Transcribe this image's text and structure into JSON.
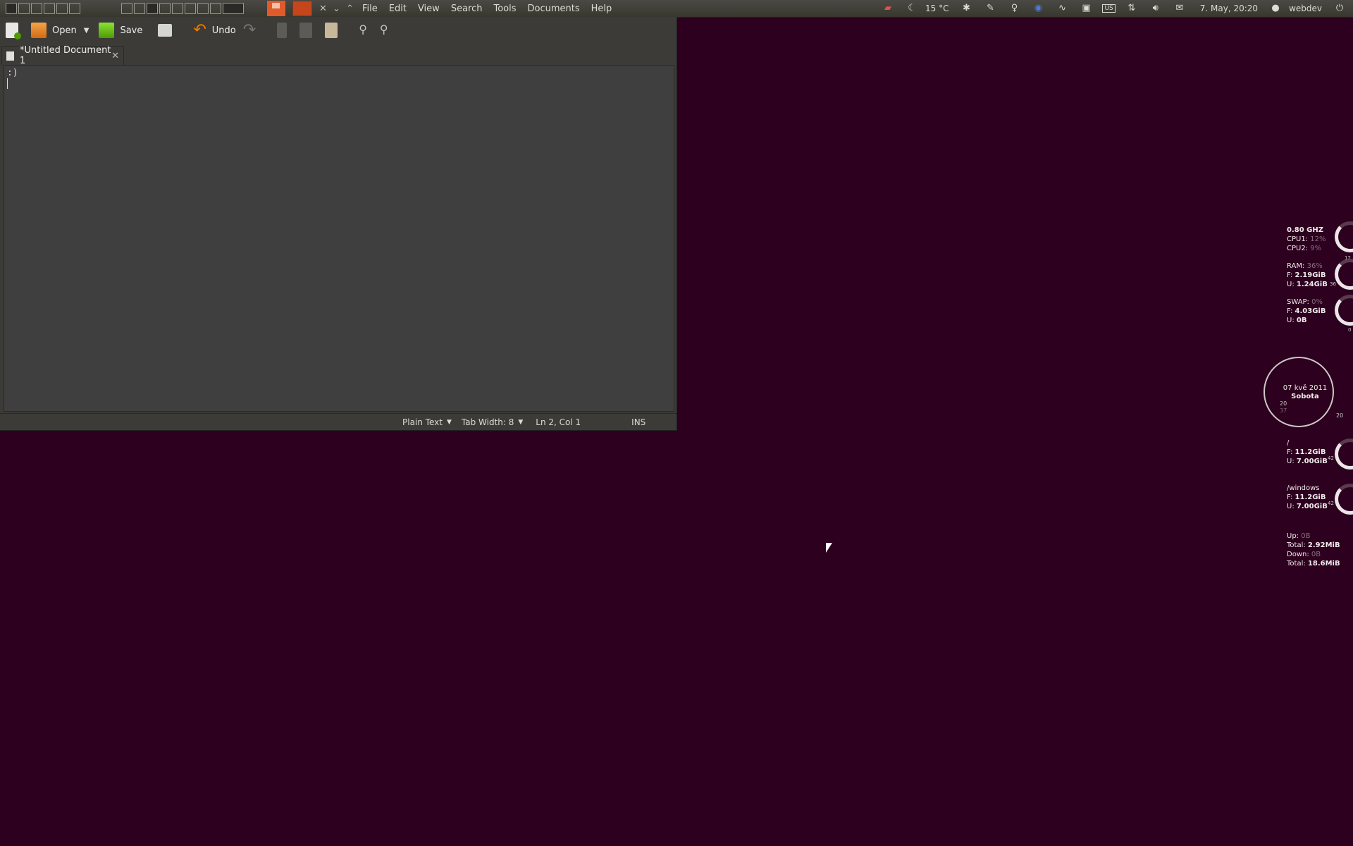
{
  "top_panel": {
    "menus": [
      "File",
      "Edit",
      "View",
      "Search",
      "Tools",
      "Documents",
      "Help"
    ],
    "window_controls": [
      "✕",
      "⌄",
      "⌃"
    ],
    "tray": {
      "weather": "15 °C",
      "keyboard_layout": "US",
      "datetime": "7. May, 20:20",
      "user": "webdev"
    }
  },
  "gedit": {
    "toolbar": {
      "open_label": "Open",
      "save_label": "Save",
      "undo_label": "Undo"
    },
    "tab": {
      "title": "*Untitled Document 1"
    },
    "editor": {
      "content": ":)"
    },
    "statusbar": {
      "language": "Plain Text",
      "tab_width": "Tab Width:  8",
      "position": "Ln 2, Col 1",
      "mode": "INS"
    }
  },
  "conky": {
    "cpu": {
      "freq": "0.80 GHZ",
      "cpu1_label": "CPU1:",
      "cpu1": "12%",
      "cpu2_label": "CPU2:",
      "cpu2": "9%",
      "gauge_num": "12"
    },
    "ram": {
      "label": "RAM:",
      "percent": "36%",
      "free_label": "F:",
      "free": "2.19GiB",
      "used_label": "U:",
      "used": "1.24GiB",
      "gauge_num": "36"
    },
    "swap": {
      "label": "SWAP:",
      "percent": "0%",
      "free_label": "F:",
      "free": "4.03GiB",
      "used_label": "U:",
      "used": "0B",
      "gauge_num": "0"
    },
    "clock": {
      "date": "07 kvě 2011",
      "day": "Sobota",
      "hour": "20",
      "minute": "20",
      "second": "37",
      "dial_num": "20"
    },
    "root_fs": {
      "label": "/",
      "free_label": "F:",
      "free": "11.2GiB",
      "used_label": "U:",
      "used": "7.00GiB",
      "gauge_num": "42"
    },
    "windows_fs": {
      "label": "/windows",
      "free_label": "F:",
      "free": "11.2GiB",
      "used_label": "U:",
      "used": "7.00GiB",
      "gauge_num": "42"
    },
    "net": {
      "up_label": "Up:",
      "up": "0B",
      "up_total_label": "Total:",
      "up_total": "2.92MiB",
      "down_label": "Down:",
      "down": "0B",
      "down_total_label": "Total:",
      "down_total": "18.6MiB"
    }
  }
}
